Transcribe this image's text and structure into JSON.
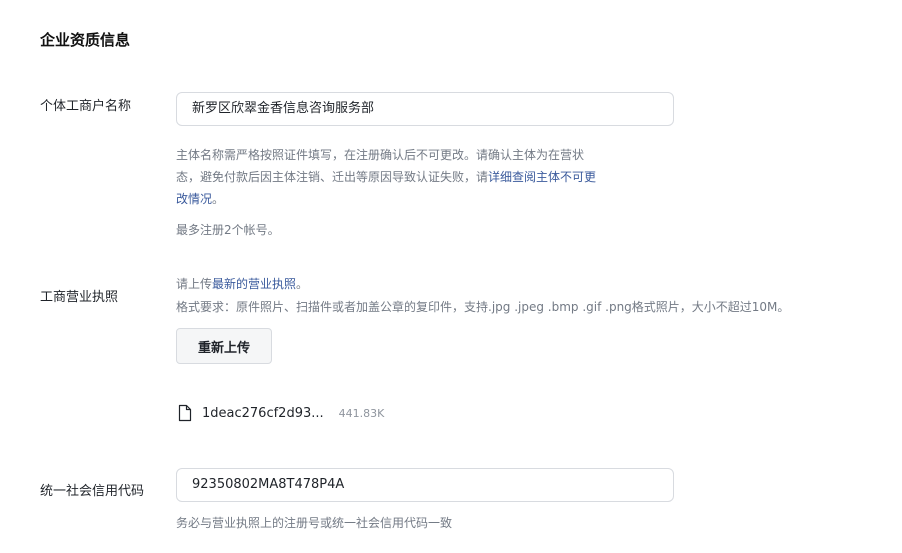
{
  "section": {
    "title": "企业资质信息"
  },
  "business_name": {
    "label": "个体工商户名称",
    "value": "新罗区欣翠金香信息咨询服务部",
    "help_line1": "主体名称需严格按照证件填写，在注册确认后不可更改。请确认主体为在营状",
    "help_line2_text": "态，避免付款后因主体注销、迁出等原因导致认证失败，请",
    "help_line2_link": "详细查阅主体不可更",
    "help_line3_link": "改情况",
    "help_line3_tail": "。",
    "limit_note": "最多注册2个帐号。"
  },
  "license": {
    "label": "工商营业执照",
    "prompt_prefix": "请上传",
    "prompt_link": "最新的营业执照",
    "prompt_suffix": "。",
    "format_note": "格式要求：原件照片、扫描件或者加盖公章的复印件，支持.jpg .jpeg .bmp .gif .png格式照片，大小不超过10M。",
    "upload_button": "重新上传",
    "file": {
      "icon": "document-icon",
      "name": "1deac276cf2d93...",
      "size": "441.83K"
    }
  },
  "credit_code": {
    "label": "统一社会信用代码",
    "value": "92350802MA8T478P4A",
    "help": "务必与营业执照上的注册号或统一社会信用代码一致"
  },
  "colors": {
    "text": "#1f2329",
    "muted": "#737a85",
    "link": "#3a5a9c",
    "border": "#d8dbe0"
  }
}
